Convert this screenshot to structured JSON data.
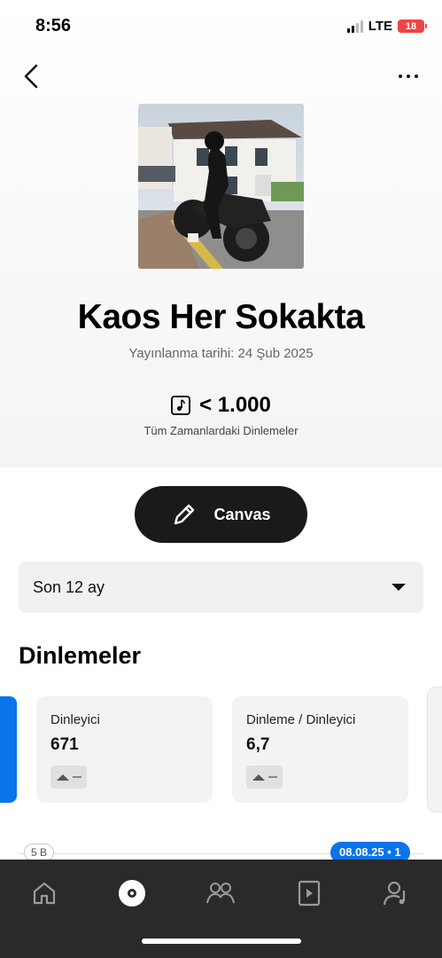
{
  "status_bar": {
    "time": "8:56",
    "network": "LTE",
    "battery": "18"
  },
  "header": {
    "back_icon": "chevron-left-icon",
    "more_icon": "more-horizontal-icon"
  },
  "track": {
    "title": "Kaos Her Sokakta",
    "release_date": "Yayınlanma tarihi: 24 Şub 2025",
    "streams_value": "< 1.000",
    "streams_label": "Tüm Zamanlardaki Dinlemeler"
  },
  "canvas_button": {
    "label": "Canvas",
    "icon": "pencil-icon"
  },
  "range_select": {
    "selected": "Son 12 ay"
  },
  "section": {
    "title": "Dinlemeler"
  },
  "stat_cards": [
    {
      "label": "Dinleyici",
      "value": "671",
      "trend": "up"
    },
    {
      "label": "Dinleme / Dinleyici",
      "value": "6,7",
      "trend": "up"
    }
  ],
  "chart": {
    "y_label": "5 B",
    "tooltip": "08.08.25 • 1"
  },
  "tabbar": {
    "items": [
      "home-icon",
      "music-icon",
      "audience-icon",
      "video-icon",
      "artist-profile-icon"
    ],
    "active_index": 1
  },
  "colors": {
    "accent": "#0a74e8",
    "tabbar": "#2a2a2a",
    "button": "#1a1a1a"
  }
}
